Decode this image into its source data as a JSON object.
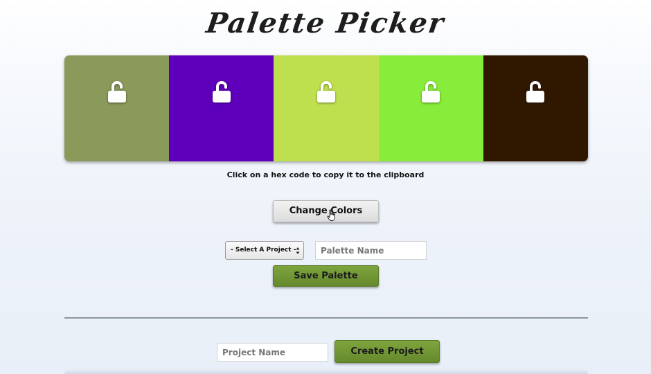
{
  "app": {
    "title": "Palette Picker"
  },
  "palette": {
    "colors": [
      "#8A9A5B",
      "#5E00BB",
      "#BFE04E",
      "#88EC3A",
      "#301800"
    ],
    "lock_icon": "unlocked-padlock-icon",
    "hint": "Click on a hex code to copy it to the clipboard"
  },
  "controls": {
    "change_colors_label": "Change Colors",
    "project_select": {
      "selected": "- Select A Project -"
    },
    "palette_name_placeholder": "Palette Name",
    "save_palette_label": "Save Palette"
  },
  "project": {
    "name_placeholder": "Project Name",
    "create_label": "Create Project"
  },
  "theme": {
    "accent_green": "#72972F",
    "divider": "#8C969E",
    "title_color": "#1E1E1E"
  }
}
